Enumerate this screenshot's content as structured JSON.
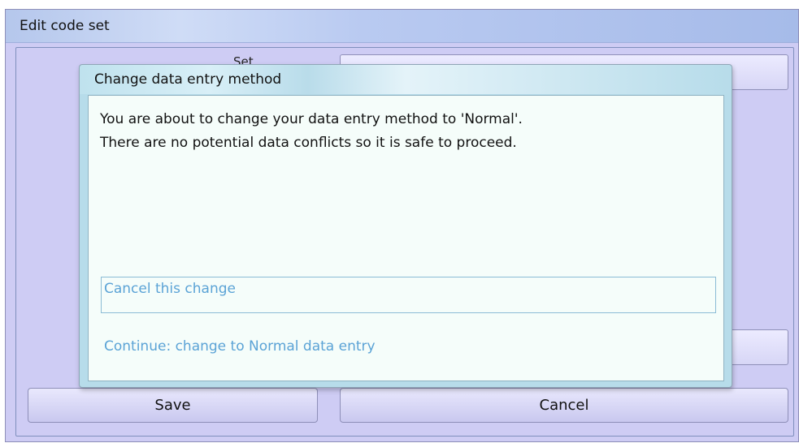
{
  "parent_window": {
    "title": "Edit code set",
    "partial_label": "Set",
    "buttons": {
      "save_label": "Save",
      "cancel_label": "Cancel"
    }
  },
  "dialog": {
    "title": "Change data entry method",
    "message_line_1": "You are about to change your data entry method to 'Normal'.",
    "message_line_2": "There are no potential data conflicts so it is safe to proceed.",
    "options": [
      {
        "label": "Cancel this change",
        "selected": true
      },
      {
        "label": "Continue: change to Normal data entry",
        "selected": false
      }
    ]
  },
  "colors": {
    "parent_background": "#ceccf4",
    "dialog_frame": "#b7dcea",
    "dialog_body": "#f5fdfa",
    "option_text": "#5ba3d6"
  }
}
